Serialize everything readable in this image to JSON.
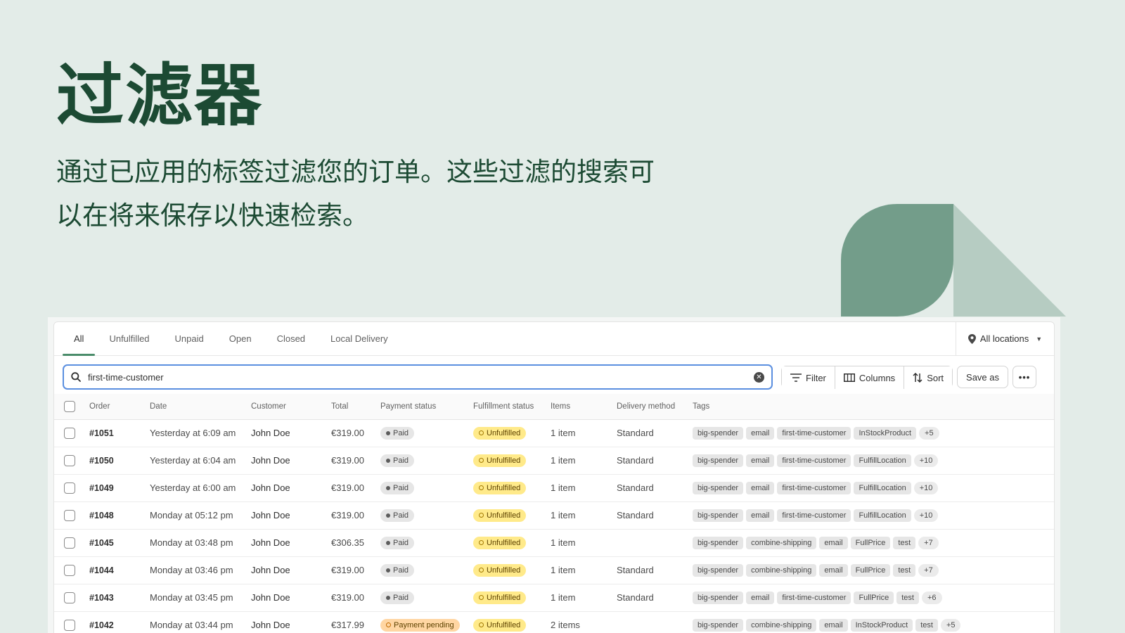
{
  "hero": {
    "title": "过滤器",
    "subtitle": "通过已应用的标签过滤您的订单。这些过滤的搜索可以在将来保存以快速检索。"
  },
  "colors": {
    "heading": "#1c4a33",
    "background": "#e3ece8",
    "deco_dark": "#739d8a",
    "deco_light": "#b6ccc2",
    "tab_underline": "#4a8c6a",
    "search_border": "#5b8fe0"
  },
  "tabs": [
    {
      "label": "All",
      "active": true
    },
    {
      "label": "Unfulfilled"
    },
    {
      "label": "Unpaid"
    },
    {
      "label": "Open"
    },
    {
      "label": "Closed"
    },
    {
      "label": "Local Delivery"
    }
  ],
  "location": {
    "label": "All locations",
    "icon": "location-pin-icon"
  },
  "search": {
    "value": "first-time-customer",
    "icon": "search-icon"
  },
  "toolbar": {
    "filter_label": "Filter",
    "columns_label": "Columns",
    "sort_label": "Sort",
    "save_label": "Save as",
    "more_label": "•••"
  },
  "table": {
    "headers": {
      "order": "Order",
      "date": "Date",
      "customer": "Customer",
      "total": "Total",
      "payment": "Payment status",
      "fulfillment": "Fulfillment status",
      "items": "Items",
      "delivery": "Delivery method",
      "tags": "Tags"
    },
    "rows": [
      {
        "order": "#1051",
        "date": "Yesterday at 6:09 am",
        "customer": "John Doe",
        "total": "€319.00",
        "payment": "Paid",
        "fulfillment": "Unfulfilled",
        "items": "1 item",
        "delivery": "Standard",
        "tags": [
          "big-spender",
          "email",
          "first-time-customer",
          "InStockProduct"
        ],
        "more": "+5"
      },
      {
        "order": "#1050",
        "date": "Yesterday at 6:04 am",
        "customer": "John Doe",
        "total": "€319.00",
        "payment": "Paid",
        "fulfillment": "Unfulfilled",
        "items": "1 item",
        "delivery": "Standard",
        "tags": [
          "big-spender",
          "email",
          "first-time-customer",
          "FulfillLocation"
        ],
        "more": "+10"
      },
      {
        "order": "#1049",
        "date": "Yesterday at 6:00 am",
        "customer": "John Doe",
        "total": "€319.00",
        "payment": "Paid",
        "fulfillment": "Unfulfilled",
        "items": "1 item",
        "delivery": "Standard",
        "tags": [
          "big-spender",
          "email",
          "first-time-customer",
          "FulfillLocation"
        ],
        "more": "+10"
      },
      {
        "order": "#1048",
        "date": "Monday at 05:12 pm",
        "customer": "John Doe",
        "total": "€319.00",
        "payment": "Paid",
        "fulfillment": "Unfulfilled",
        "items": "1 item",
        "delivery": "Standard",
        "tags": [
          "big-spender",
          "email",
          "first-time-customer",
          "FulfillLocation"
        ],
        "more": "+10"
      },
      {
        "order": "#1045",
        "date": "Monday at 03:48 pm",
        "customer": "John Doe",
        "total": "€306.35",
        "payment": "Paid",
        "fulfillment": "Unfulfilled",
        "items": "1 item",
        "delivery": "",
        "tags": [
          "big-spender",
          "combine-shipping",
          "email",
          "FullPrice",
          "test"
        ],
        "more": "+7"
      },
      {
        "order": "#1044",
        "date": "Monday at 03:46 pm",
        "customer": "John Doe",
        "total": "€319.00",
        "payment": "Paid",
        "fulfillment": "Unfulfilled",
        "items": "1 item",
        "delivery": "Standard",
        "tags": [
          "big-spender",
          "combine-shipping",
          "email",
          "FullPrice",
          "test"
        ],
        "more": "+7"
      },
      {
        "order": "#1043",
        "date": "Monday at 03:45 pm",
        "customer": "John Doe",
        "total": "€319.00",
        "payment": "Paid",
        "fulfillment": "Unfulfilled",
        "items": "1 item",
        "delivery": "Standard",
        "tags": [
          "big-spender",
          "email",
          "first-time-customer",
          "FullPrice",
          "test"
        ],
        "more": "+6"
      },
      {
        "order": "#1042",
        "date": "Monday at 03:44 pm",
        "customer": "John Doe",
        "total": "€317.99",
        "payment": "Payment pending",
        "fulfillment": "Unfulfilled",
        "items": "2 items",
        "delivery": "",
        "tags": [
          "big-spender",
          "combine-shipping",
          "email",
          "InStockProduct",
          "test"
        ],
        "more": "+5"
      }
    ]
  }
}
